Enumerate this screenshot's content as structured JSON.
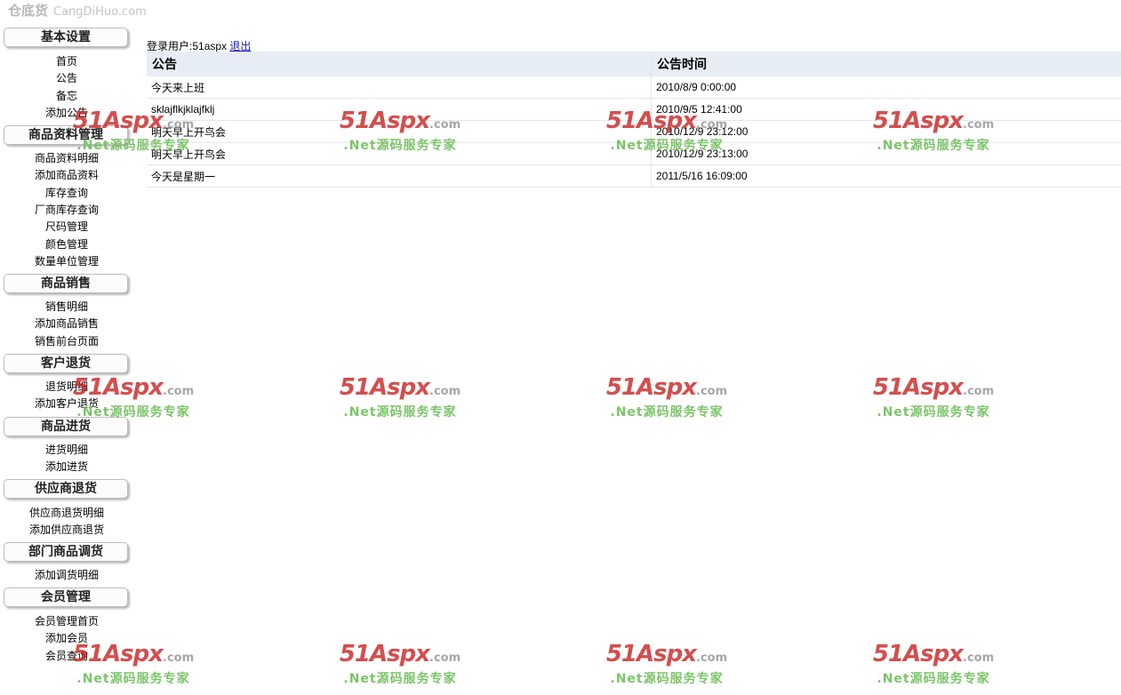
{
  "site": {
    "cn_name": "仓底货",
    "domain": "CangDiHuo.com"
  },
  "sidebar": {
    "sections": [
      {
        "title": "基本设置",
        "items": [
          "首页",
          "公告",
          "备忘",
          "添加公告"
        ]
      },
      {
        "title": "商品资料管理",
        "items": [
          "商品资料明细",
          "添加商品资料",
          "库存查询",
          "厂商库存查询",
          "尺码管理",
          "颜色管理",
          "数量单位管理"
        ]
      },
      {
        "title": "商品销售",
        "items": [
          "销售明细",
          "添加商品销售",
          "销售前台页面"
        ]
      },
      {
        "title": "客户退货",
        "items": [
          "退货明细",
          "添加客户退货"
        ]
      },
      {
        "title": "商品进货",
        "items": [
          "进货明细",
          "添加进货"
        ]
      },
      {
        "title": "供应商退货",
        "items": [
          "供应商退货明细",
          "添加供应商退货"
        ]
      },
      {
        "title": "部门商品调货",
        "items": [
          "添加调货明细"
        ]
      },
      {
        "title": "会员管理",
        "items": [
          "会员管理首页",
          "添加会员",
          "会员查询"
        ]
      }
    ]
  },
  "header": {
    "login_label": "登录用户:",
    "username": "51aspx",
    "logout_label": "退出"
  },
  "notices": {
    "columns": [
      "公告",
      "公告时间"
    ],
    "rows": [
      {
        "title": "今天来上班",
        "time": "2010/8/9 0:00:00"
      },
      {
        "title": "sklajflkjklajfklj",
        "time": "2010/9/5 12:41:00"
      },
      {
        "title": "明天早上开鸟会",
        "time": "2010/12/9 23:12:00"
      },
      {
        "title": "明天早上开鸟会",
        "time": "2010/12/9 23:13:00"
      },
      {
        "title": "今天是星期一",
        "time": "2011/5/16 16:09:00"
      }
    ]
  },
  "watermark": {
    "brand": "51Aspx",
    "suffix": ".com",
    "tagline": ".Net源码服务专家"
  }
}
